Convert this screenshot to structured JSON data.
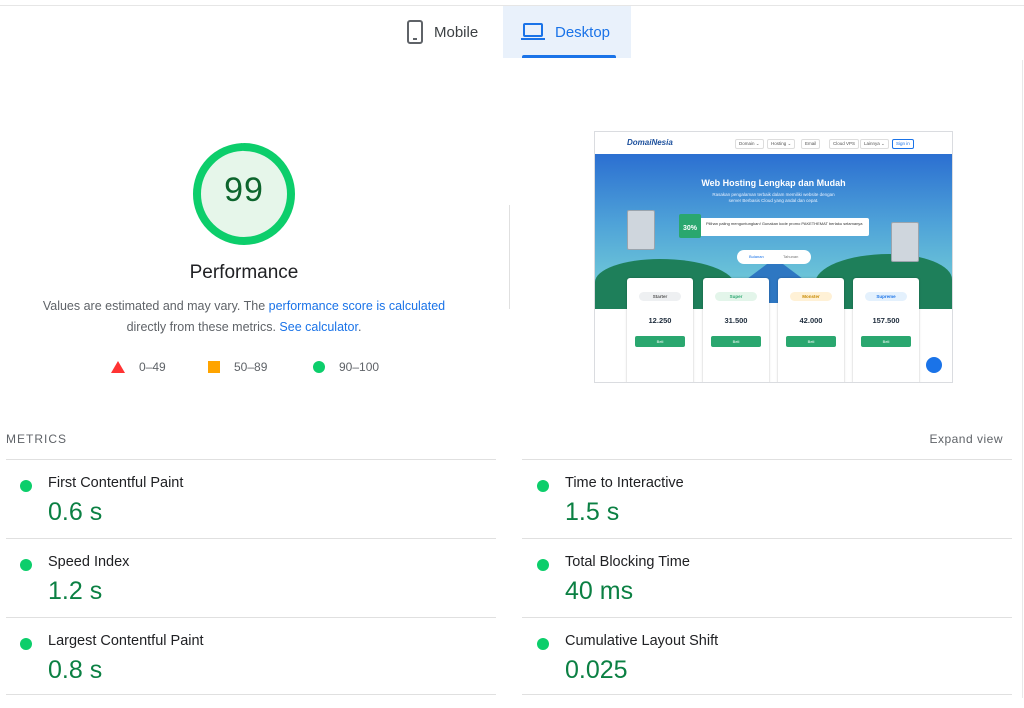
{
  "tabs": {
    "mobile_label": "Mobile",
    "desktop_label": "Desktop",
    "active": "Desktop"
  },
  "score": {
    "value": "99",
    "fraction": 0.99,
    "title": "Performance",
    "color": "#0cce6b",
    "track_color": "#e6f6ea"
  },
  "description": {
    "text1": "Values are estimated and may vary. The ",
    "link1": "performance score is calculated",
    "text2": " directly from these metrics. ",
    "link2": "See calculator",
    "text3": "."
  },
  "legend": {
    "fail": "0–49",
    "average": "50–89",
    "pass": "90–100"
  },
  "thumbnail": {
    "logo": "DomaiNesia",
    "nav_items": [
      "Domain ⌄",
      "Hosting ⌄",
      "Email",
      "Cloud VPS",
      "Lainnya ⌄",
      "Sign in"
    ],
    "hero_title": "Web Hosting Lengkap dan Mudah",
    "hero_subtitle_1": "Rasakan pengalaman terbaik dalam memiliki website dengan",
    "hero_subtitle_2": "server Berbasis Cloud yang andal dan cepat.",
    "promo_badge": "30%",
    "promo_text": "Pilihan paling menguntungkan! Gunakan kode promo PAKETHEMAT berlaku selamanya",
    "toggle_left": "Bulanan",
    "toggle_right": "Tahunan",
    "tag_best": "BEST VALUE",
    "tag_popular": "JUST BERANAKAN",
    "plans": [
      {
        "name": "Starter",
        "price": "12.250"
      },
      {
        "name": "Super",
        "price": "31.500"
      },
      {
        "name": "Monster",
        "price": "42.000"
      },
      {
        "name": "Supreme",
        "price": "157.500"
      }
    ],
    "buy_label": "Beli"
  },
  "metrics": {
    "title": "METRICS",
    "expand": "Expand view",
    "items": [
      {
        "label": "First Contentful Paint",
        "value": "0.6 s"
      },
      {
        "label": "Time to Interactive",
        "value": "1.5 s"
      },
      {
        "label": "Speed Index",
        "value": "1.2 s"
      },
      {
        "label": "Total Blocking Time",
        "value": "40 ms"
      },
      {
        "label": "Largest Contentful Paint",
        "value": "0.8 s"
      },
      {
        "label": "Cumulative Layout Shift",
        "value": "0.025"
      }
    ],
    "status_color": "#0cce6b"
  }
}
